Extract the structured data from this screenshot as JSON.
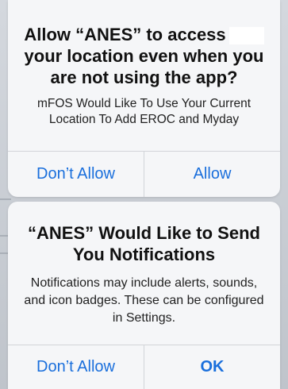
{
  "location_alert": {
    "title": "Allow “ANES” to access",
    "title_line2": "your location even when you are not using the app?",
    "message": "mFOS Would Like To Use Your Current Location To Add EROC and Myday",
    "deny_label": "Don’t Allow",
    "allow_label": "Allow"
  },
  "notification_alert": {
    "title": "“ANES” Would Like to Send You Notifications",
    "message": "Notifications may include alerts, sounds, and icon badges. These can be configured in Settings.",
    "deny_label": "Don’t Allow",
    "allow_label": "OK"
  },
  "colors": {
    "action_blue": "#1a6fdc",
    "alert_background": "#f5f6f8"
  }
}
